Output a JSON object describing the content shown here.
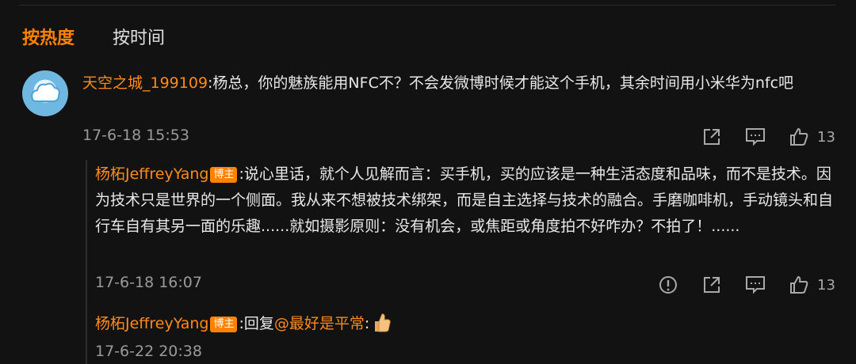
{
  "sort": {
    "hot": "按热度",
    "time": "按时间"
  },
  "comment": {
    "user": "天空之城_199109",
    "text": ":杨总，你的魅族能用NFC不？不会发微博时候才能这个手机，其余时间用小米华为nfc吧",
    "time": "17-6-18 15:53",
    "likes": "13"
  },
  "replies": [
    {
      "user": "杨柘JeffreyYang",
      "badge": "博主",
      "text": ":说心里话，就个人见解而言：买手机，买的应该是一种生活态度和品味，而不是技术。因为技术只是世界的一个侧面。我从来不想被技术绑架，而是自主选择与技术的融合。手磨咖啡机，手动镜头和自行车自有其另一面的乐趣......就如摄影原则：没有机会，或焦距或角度拍不好咋办？不拍了！......",
      "time": "17-6-18 16:07",
      "likes": "13"
    },
    {
      "user": "杨柘JeffreyYang",
      "badge": "博主",
      "prefix": ":回复",
      "mention": "@最好是平常",
      "suffix": ":",
      "emoji": "thumbs-up-emoji",
      "time": "17-6-22 20:38"
    }
  ],
  "icons": [
    "share-icon",
    "comment-icon",
    "like-icon",
    "report-icon"
  ],
  "colors": {
    "accent": "#ff8200",
    "background": "#121212",
    "username": "#ff8a1c"
  }
}
